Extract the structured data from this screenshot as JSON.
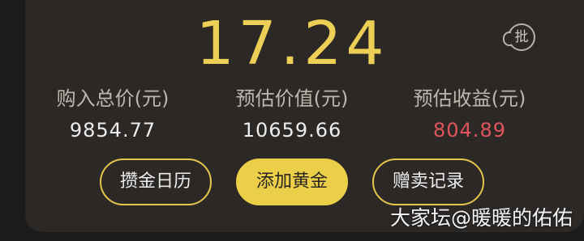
{
  "gold": {
    "price": "17.24",
    "badge_label": "批"
  },
  "stats": [
    {
      "label": "购入总价(元)",
      "value": "9854.77"
    },
    {
      "label": "预估价值(元)",
      "value": "10659.66"
    },
    {
      "label": "预估收益(元)",
      "value": "804.89"
    }
  ],
  "buttons": {
    "calendar": "攒金日历",
    "add_gold": "添加黄金",
    "records": "赠卖记录"
  },
  "watermark": "大家坛@暖暖的佑佑",
  "colors": {
    "accent_gold": "#eccf54",
    "profit_red": "#e0555b",
    "card_bg": "#2b2826"
  }
}
